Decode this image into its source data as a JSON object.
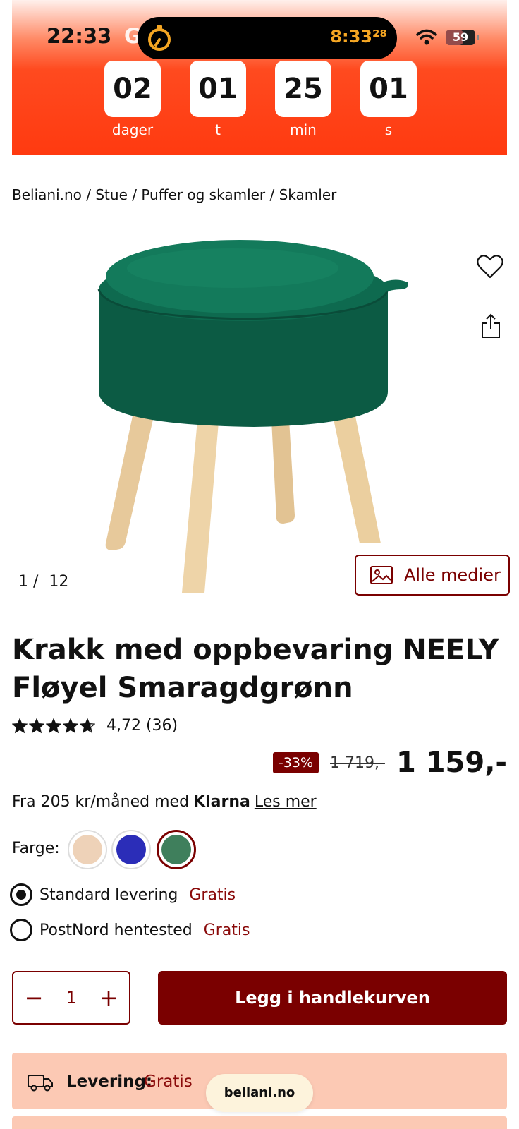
{
  "status_bar": {
    "time": "22:33",
    "app_letter": "G",
    "live_activity_time": "8:33²⁸",
    "battery": "59"
  },
  "countdown": [
    {
      "value": "02",
      "label": "dager"
    },
    {
      "value": "01",
      "label": "t"
    },
    {
      "value": "25",
      "label": "min"
    },
    {
      "value": "01",
      "label": "s"
    }
  ],
  "breadcrumb": {
    "items": [
      "Beliani.no",
      "Stue",
      "Puffer og skamler",
      "Skamler"
    ],
    "separator": " / "
  },
  "gallery": {
    "current": "1",
    "total": "12",
    "separator": "/",
    "media_button": "Alle medier"
  },
  "product": {
    "title": "Krakk med oppbevaring NEELY Fløyel Smaragdgrønn",
    "rating_value": 4.72,
    "rating_text": "4,72 (36)",
    "stars_total": 5
  },
  "price": {
    "discount": "-33%",
    "old": "1 719,-",
    "new": "1 159,-"
  },
  "financing": {
    "prefix": "Fra 205 kr/måned med",
    "provider": "Klarna",
    "link": "Les mer"
  },
  "colors": {
    "label": "Farge:",
    "options": [
      {
        "color": "#eed2b8",
        "selected": false
      },
      {
        "color": "#2b2db8",
        "selected": false
      },
      {
        "color": "#3f7f5c",
        "selected": true
      }
    ]
  },
  "delivery_options": [
    {
      "label": "Standard levering",
      "price": "Gratis",
      "checked": true
    },
    {
      "label": "PostNord hentested",
      "price": "Gratis",
      "checked": false
    }
  ],
  "cart": {
    "quantity": "1",
    "minus": "−",
    "plus": "+",
    "add_button": "Legg i handlekurven"
  },
  "delivery_info": {
    "label": "Levering:",
    "value": "Gratis"
  },
  "browser": {
    "url": "beliani.no"
  },
  "theme": {
    "accent": "#7a0000",
    "banner": "#ff3a10",
    "info_bg": "#fcc9b4"
  }
}
